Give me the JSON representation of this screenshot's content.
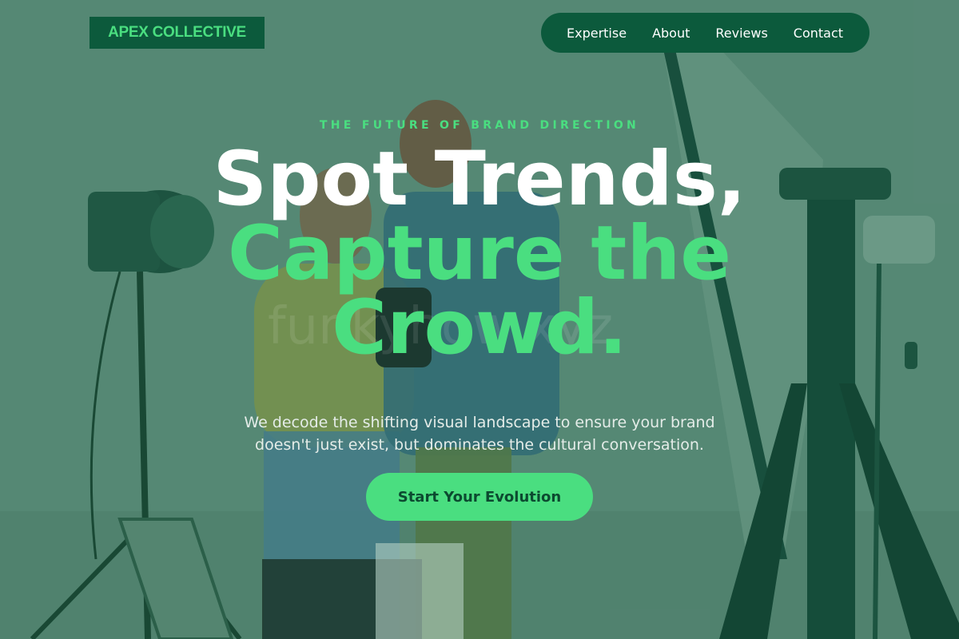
{
  "brand": {
    "logo": "APEX COLLECTIVE"
  },
  "nav": {
    "items": [
      "Expertise",
      "About",
      "Reviews",
      "Contact"
    ]
  },
  "hero": {
    "eyebrow": "THE FUTURE OF BRAND DIRECTION",
    "headline_line1": "Spot Trends,",
    "headline_line2": "Capture the",
    "headline_line3": "Crowd.",
    "subtitle": "We decode the shifting visual landscape to ensure your brand doesn't just exist, but dominates the cultural conversation.",
    "cta_label": "Start Your Evolution",
    "watermark": "funkyhow.xyz"
  },
  "colors": {
    "accent": "#4ade80",
    "dark_green": "#0c5a3c",
    "overlay": "#5f8d7c"
  }
}
